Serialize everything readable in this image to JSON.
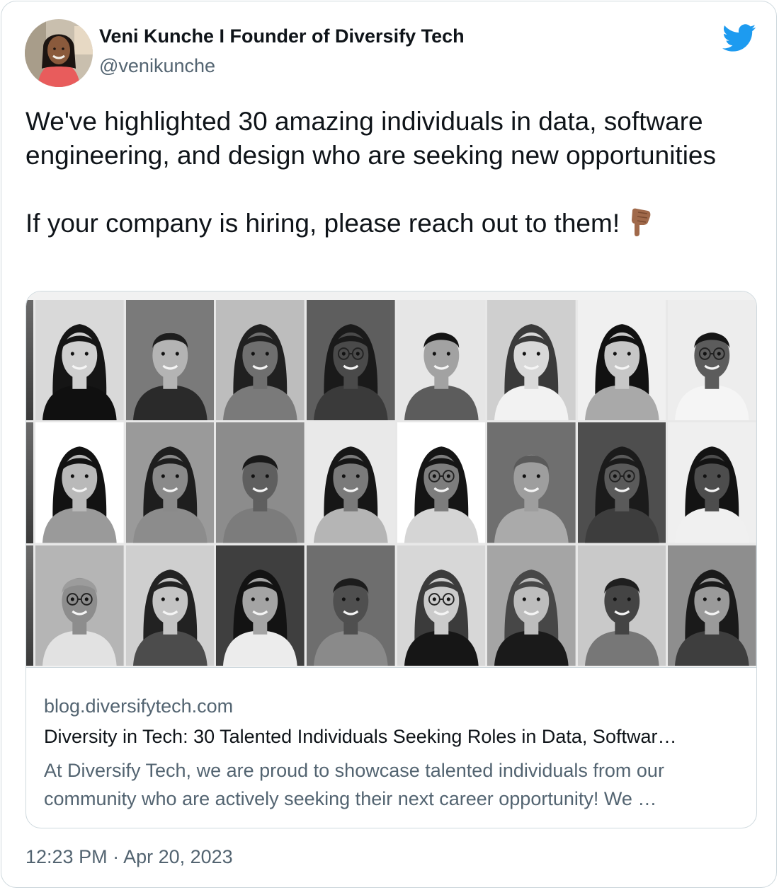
{
  "author": {
    "name": "Veni Kunche I Founder of Diversify Tech",
    "handle": "@venikunche",
    "avatar_icon": "profile-photo"
  },
  "brand": {
    "icon": "twitter-bird-icon",
    "color": "#1d9bf0"
  },
  "tweet": {
    "line1": "We've highlighted 30 amazing individuals in data, software engineering, and design who are seeking new opportunities",
    "line2": "If your company is hiring, please reach out to them!",
    "emoji": "backhand-index-pointing-down-icon"
  },
  "link_card": {
    "image_alt": "Grid of 24 black and white portrait photos",
    "domain": "blog.diversifytech.com",
    "title": "Diversity in Tech: 30 Talented Individuals Seeking Roles in Data, Softwar…",
    "description": "At Diversify Tech, we are proud to showcase talented individuals from our community who are actively seeking their next career opportunity! We …"
  },
  "timestamp": "12:23 PM · Apr 20, 2023",
  "colors": {
    "text": "#0f1419",
    "secondary": "#536471",
    "border": "#cfd9de"
  }
}
